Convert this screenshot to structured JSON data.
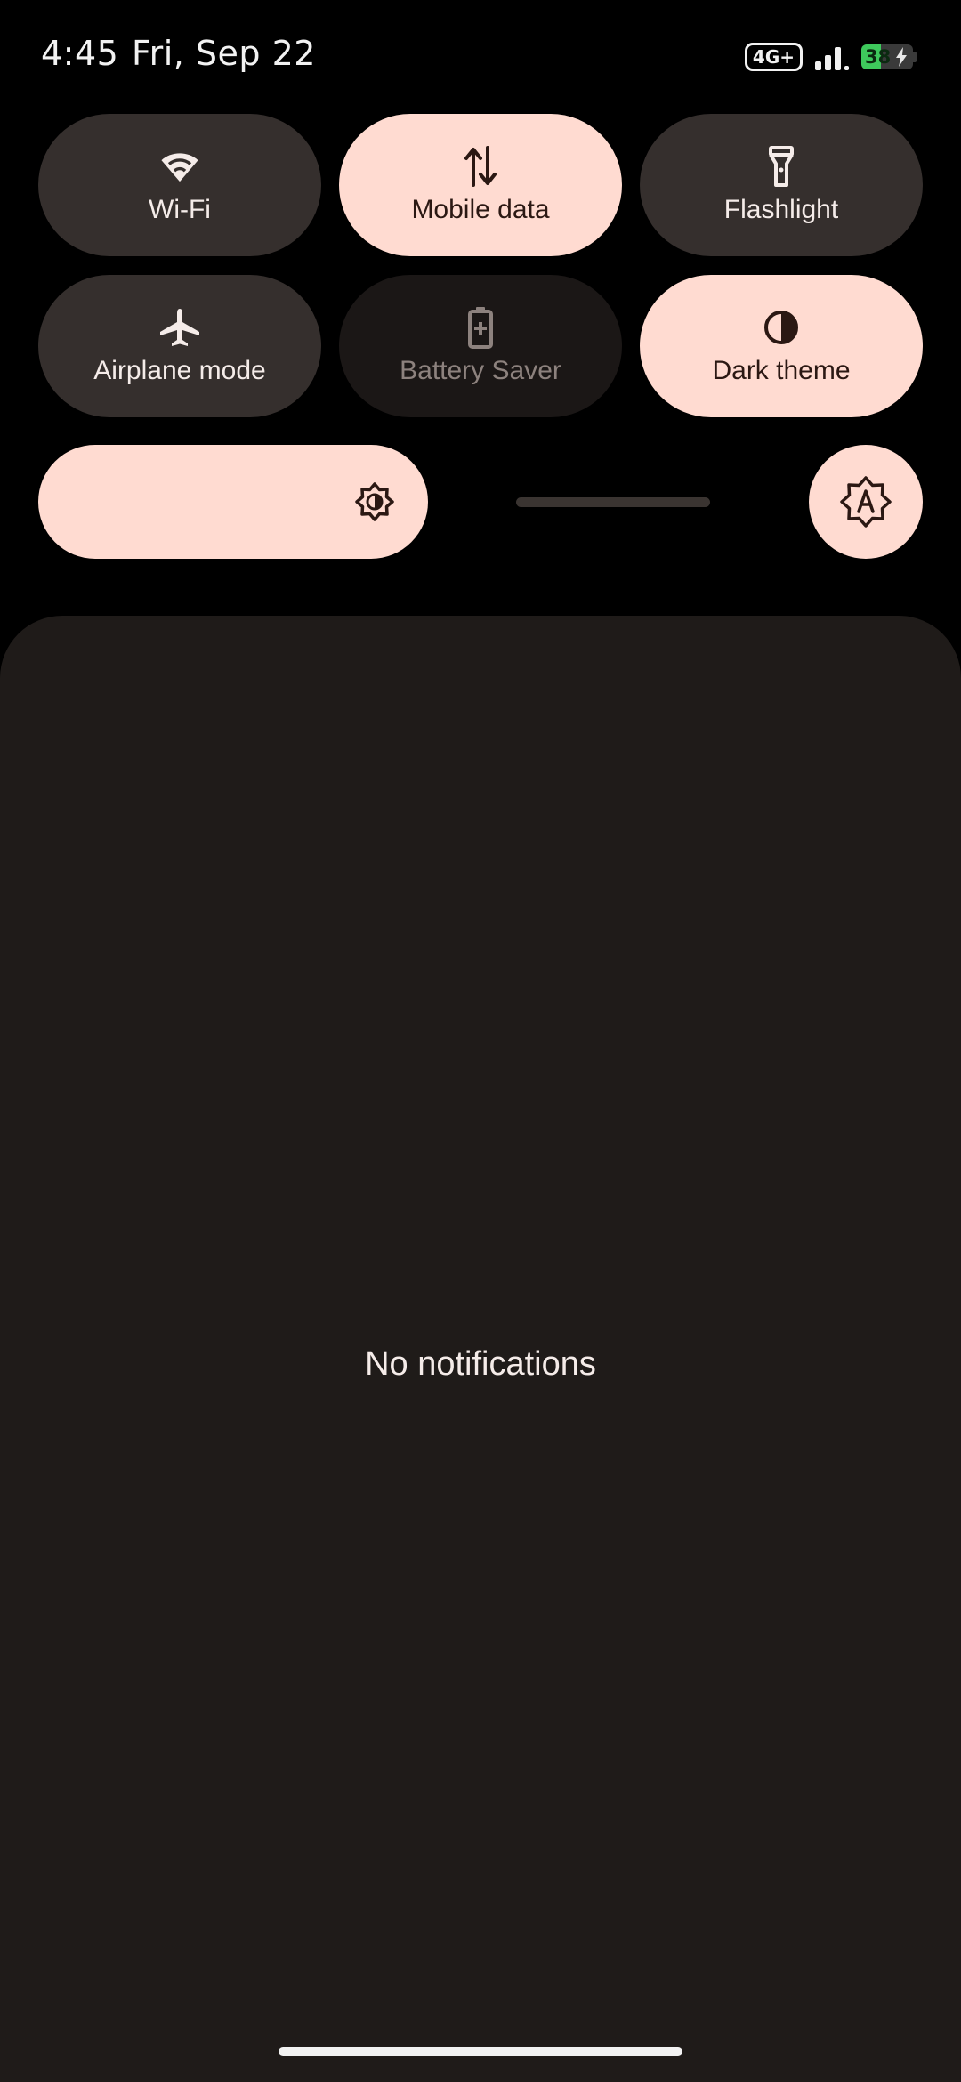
{
  "status_bar": {
    "time": "4:45",
    "date": "Fri, Sep 22",
    "network_type": "4G+",
    "signal_icon": "signal-strength-icon",
    "battery_level": 38,
    "battery_text": "38",
    "battery_charging": true,
    "battery_color": "#3ec95c"
  },
  "quick_settings": {
    "tiles": [
      {
        "label": "Wi-Fi",
        "icon": "wifi-icon",
        "state": "off"
      },
      {
        "label": "Mobile data",
        "icon": "mobile-data-icon",
        "state": "on"
      },
      {
        "label": "Flashlight",
        "icon": "flashlight-icon",
        "state": "off"
      },
      {
        "label": "Airplane mode",
        "icon": "airplane-icon",
        "state": "off"
      },
      {
        "label": "Battery Saver",
        "icon": "battery-saver-icon",
        "state": "disabled"
      },
      {
        "label": "Dark theme",
        "icon": "dark-theme-icon",
        "state": "on"
      }
    ],
    "brightness": {
      "level": 0.58,
      "icon": "brightness-icon",
      "auto_icon": "auto-brightness-icon"
    }
  },
  "notifications": {
    "empty_text": "No notifications"
  },
  "colors": {
    "tile_on": "#ffdbd1",
    "tile_off": "#352f2d",
    "panel": "#1f1b19"
  }
}
